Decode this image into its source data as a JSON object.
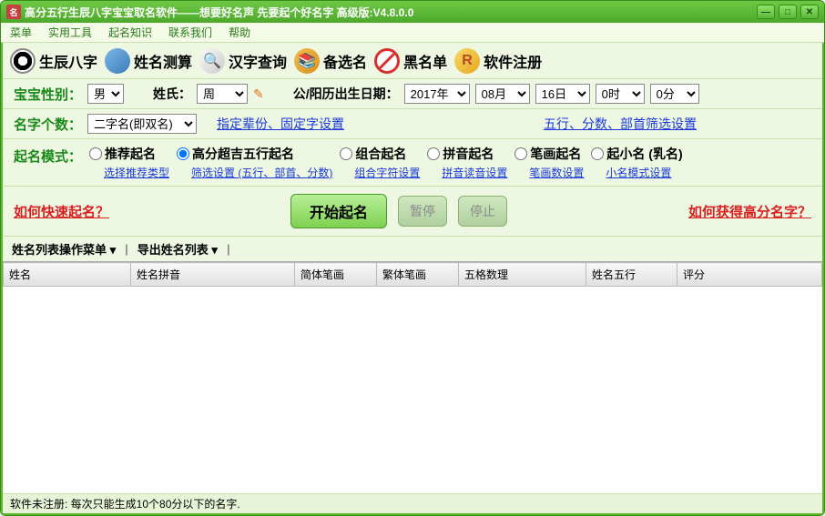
{
  "title": "高分五行生辰八字宝宝取名软件——想要好名声 先要起个好名字  高级版:V4.8.0.0",
  "menu": [
    "菜单",
    "实用工具",
    "起名知识",
    "联系我们",
    "帮助"
  ],
  "tools": [
    {
      "label": "生辰八字",
      "icon": "bagua"
    },
    {
      "label": "姓名测算",
      "icon": "globe"
    },
    {
      "label": "汉字查询",
      "icon": "mag"
    },
    {
      "label": "备选名",
      "icon": "book"
    },
    {
      "label": "黑名单",
      "icon": "forbid"
    },
    {
      "label": "软件注册",
      "icon": "reg",
      "glyph": "R"
    }
  ],
  "form": {
    "gender_label": "宝宝性别：",
    "gender": "男",
    "surname_label": "姓氏：",
    "surname": "周",
    "birth_label": "公/阳历出生日期：",
    "year": "2017年",
    "month": "08月",
    "day": "16日",
    "hour": "0时",
    "minute": "0分",
    "count_label": "名字个数：",
    "count": "二字名(即双名)",
    "link_fixed": "指定辈份、固定字设置",
    "link_filter": "五行、分数、部首筛选设置",
    "mode_label": "起名模式："
  },
  "modes": [
    {
      "label": "推荐起名",
      "sub": "选择推荐类型"
    },
    {
      "label": "高分超吉五行起名",
      "sub": "筛选设置 (五行、部首、分数)",
      "checked": true
    },
    {
      "label": "组合起名",
      "sub": "组合字符设置"
    },
    {
      "label": "拼音起名",
      "sub": "拼音读音设置"
    },
    {
      "label": "笔画起名",
      "sub": "笔画数设置"
    },
    {
      "label": "起小名 (乳名)",
      "sub": "小名模式设置"
    }
  ],
  "actions": {
    "help_fast": "如何快速起名？",
    "start": "开始起名",
    "pause": "暂停",
    "stop": "停止",
    "help_high": "如何获得高分名字？"
  },
  "list_ops": {
    "menu": "姓名列表操作菜单",
    "export": "导出姓名列表"
  },
  "columns": [
    "姓名",
    "姓名拼音",
    "简体笔画",
    "繁体笔画",
    "五格数理",
    "姓名五行",
    "评分"
  ],
  "status": "软件未注册: 每次只能生成10个80分以下的名字."
}
